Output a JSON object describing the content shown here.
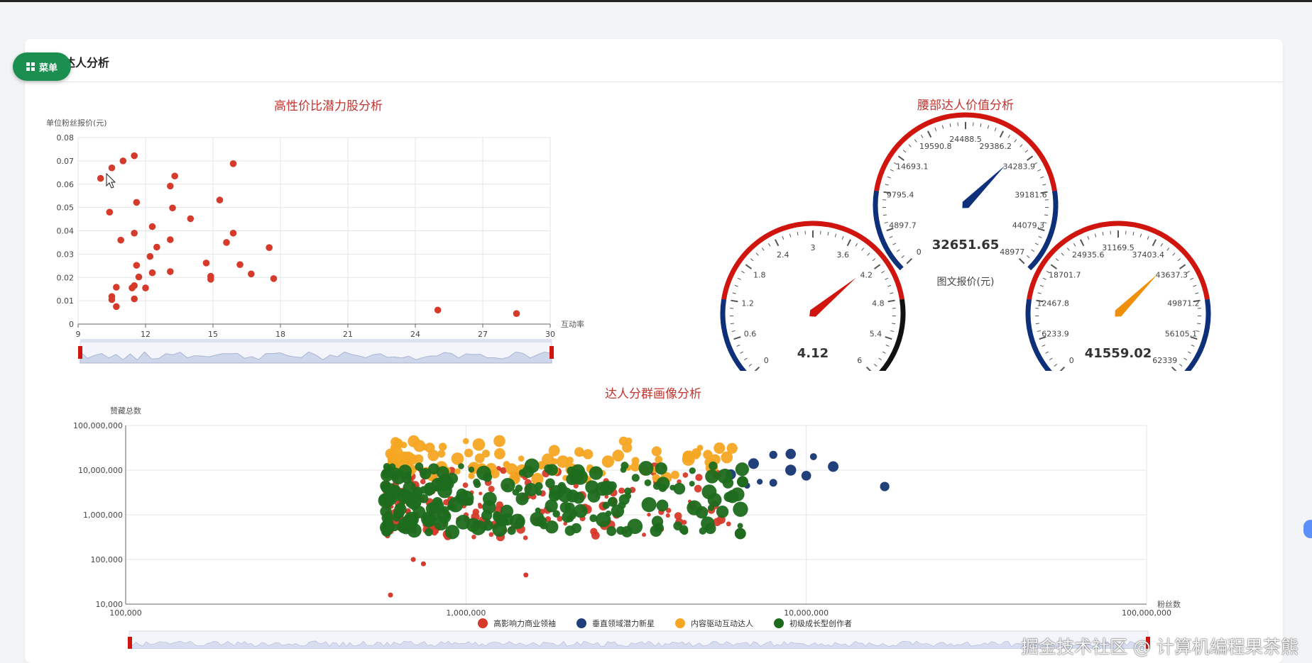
{
  "page": {
    "title": "达人分析",
    "menu_label": "菜单",
    "watermark": "掘金技术社区 @ 计算机编程果茶熊"
  },
  "colors": {
    "red": "#d63a2a",
    "navy": "#213f7a",
    "orange": "#f6a623",
    "green": "#1e6b1e",
    "title_red": "#c23531",
    "gauge_red": "#d0140e",
    "gauge_blue": "#0e2f7a"
  },
  "chart_data": [
    {
      "type": "scatter",
      "title": "高性价比潜力股分析",
      "xlabel": "互动率",
      "ylabel": "单位粉丝报价(元)",
      "xlim": [
        9,
        30
      ],
      "ylim": [
        0,
        0.08
      ],
      "xticks": [
        "9",
        "12",
        "15",
        "18",
        "21",
        "24",
        "27",
        "30"
      ],
      "yticks": [
        "0",
        "0.01",
        "0.02",
        "0.03",
        "0.04",
        "0.05",
        "0.06",
        "0.07",
        "0.08"
      ],
      "grid": true,
      "datazoom": true,
      "points": [
        [
          10.0,
          0.0625
        ],
        [
          10.5,
          0.067
        ],
        [
          11.0,
          0.07
        ],
        [
          11.5,
          0.0722
        ],
        [
          10.4,
          0.048
        ],
        [
          11.6,
          0.0522
        ],
        [
          10.9,
          0.036
        ],
        [
          11.5,
          0.039
        ],
        [
          10.5,
          0.0118
        ],
        [
          10.5,
          0.0105
        ],
        [
          10.7,
          0.0158
        ],
        [
          10.7,
          0.0075
        ],
        [
          11.4,
          0.0155
        ],
        [
          11.5,
          0.0165
        ],
        [
          11.6,
          0.0252
        ],
        [
          11.7,
          0.0202
        ],
        [
          11.5,
          0.0108
        ],
        [
          12.0,
          0.0155
        ],
        [
          12.2,
          0.029
        ],
        [
          12.3,
          0.022
        ],
        [
          12.5,
          0.033
        ],
        [
          12.3,
          0.0418
        ],
        [
          13.1,
          0.0225
        ],
        [
          13.1,
          0.0362
        ],
        [
          13.1,
          0.0592
        ],
        [
          13.3,
          0.0635
        ],
        [
          13.2,
          0.0498
        ],
        [
          14.0,
          0.0452
        ],
        [
          14.7,
          0.0262
        ],
        [
          14.9,
          0.0192
        ],
        [
          14.9,
          0.0205
        ],
        [
          15.3,
          0.0532
        ],
        [
          15.6,
          0.035
        ],
        [
          15.9,
          0.0688
        ],
        [
          15.9,
          0.039
        ],
        [
          16.2,
          0.0255
        ],
        [
          16.7,
          0.0215
        ],
        [
          17.5,
          0.0328
        ],
        [
          17.7,
          0.0195
        ],
        [
          25.0,
          0.006
        ],
        [
          28.5,
          0.0045
        ]
      ]
    },
    {
      "type": "gauge",
      "title": "腰部达人价值分析",
      "gauges": [
        {
          "name": "center",
          "value_label": "32651.65",
          "value": 32651.65,
          "min": 0,
          "max": 48977,
          "label": "图文报价(元)",
          "tick_labels": [
            "0",
            "4897.7",
            "9795.4",
            "14693.1",
            "19590.8",
            "24488.5",
            "29386.2",
            "34283.9",
            "39181.6",
            "44079.3",
            "48977"
          ],
          "pointer_color": "#0e2f7a"
        },
        {
          "name": "left",
          "value_label": "4.12",
          "value": 4.12,
          "min": 0,
          "max": 6,
          "tick_labels": [
            "0",
            "0.6",
            "1.2",
            "1.8",
            "2.4",
            "3",
            "3.6",
            "4.2",
            "4.8",
            "5.4",
            "6"
          ],
          "pointer_color": "#d0140e"
        },
        {
          "name": "right",
          "value_label": "41559.02",
          "value": 41559.02,
          "min": 0,
          "max": 62339,
          "tick_labels": [
            "0",
            "6233.9",
            "12467.8",
            "18701.7",
            "24935.6",
            "31169.5",
            "37403.4",
            "43637.3",
            "49871.2",
            "56105.1",
            "62339"
          ],
          "pointer_color": "#f0900a"
        }
      ]
    },
    {
      "type": "scatter",
      "title": "达人分群画像分析",
      "xlabel": "粉丝数",
      "ylabel": "赞藏总数",
      "x_scale": "log",
      "y_scale": "log",
      "xlim": [
        100000,
        100000000
      ],
      "ylim": [
        10000,
        100000000
      ],
      "xticks": [
        "100,000",
        "1,000,000",
        "10,000,000",
        "100,000,000"
      ],
      "yticks": [
        "10,000",
        "100,000",
        "1,000,000",
        "10,000,000",
        "100,000,000"
      ],
      "grid": true,
      "legend_position": "bottom",
      "datazoom": true,
      "series": [
        {
          "name": "高影响力商业领袖",
          "color": "#d63a2a",
          "x_range": [
            580000,
            6000000
          ],
          "y_range": [
            300000,
            12000000
          ],
          "outliers": [
            [
              600000,
              16000
            ],
            [
              1500000,
              45000
            ],
            [
              750000,
              80000
            ],
            [
              700000,
              100000
            ]
          ]
        },
        {
          "name": "垂直领域潜力新星",
          "color": "#213f7a",
          "points": [
            [
              8000000,
              22000000
            ],
            [
              9000000,
              23000000
            ],
            [
              10500000,
              20000000
            ],
            [
              7000000,
              14000000
            ],
            [
              12000000,
              12000000
            ],
            [
              6000000,
              8000000
            ],
            [
              10000000,
              7500000
            ],
            [
              6700000,
              4500000
            ],
            [
              8000000,
              5200000
            ],
            [
              7300000,
              5500000
            ],
            [
              17000000,
              4300000
            ],
            [
              9000000,
              10000000
            ]
          ]
        },
        {
          "name": "内容驱动互动达人",
          "color": "#f6a623",
          "x_range": [
            600000,
            6200000
          ],
          "y_range": [
            6000000,
            45000000
          ]
        },
        {
          "name": "初级成长型创作者",
          "color": "#1e6b1e",
          "x_range": [
            580000,
            6500000
          ],
          "y_range": [
            400000,
            13000000
          ],
          "outliers": [
            [
              6500000,
              5500000
            ],
            [
              6400000,
              380000
            ]
          ]
        }
      ]
    }
  ]
}
